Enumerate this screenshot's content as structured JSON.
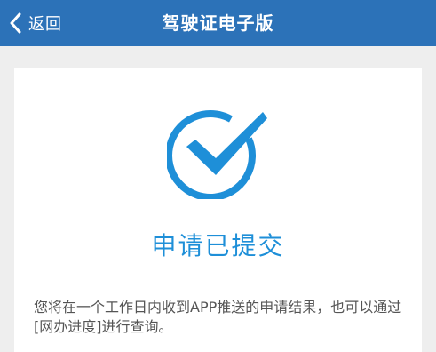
{
  "header": {
    "back_label": "返回",
    "title": "驾驶证电子版"
  },
  "result": {
    "status_text": "申请已提交",
    "notice": "您将在一个工作日内收到APP推送的申请结果，也可以通过[网办进度]进行查询。"
  },
  "colors": {
    "header_bg": "#2c72b8",
    "accent": "#1e8fd8",
    "page_bg": "#eeeeee"
  },
  "icons": {
    "back": "chevron-left-icon",
    "status": "check-circle-icon"
  }
}
